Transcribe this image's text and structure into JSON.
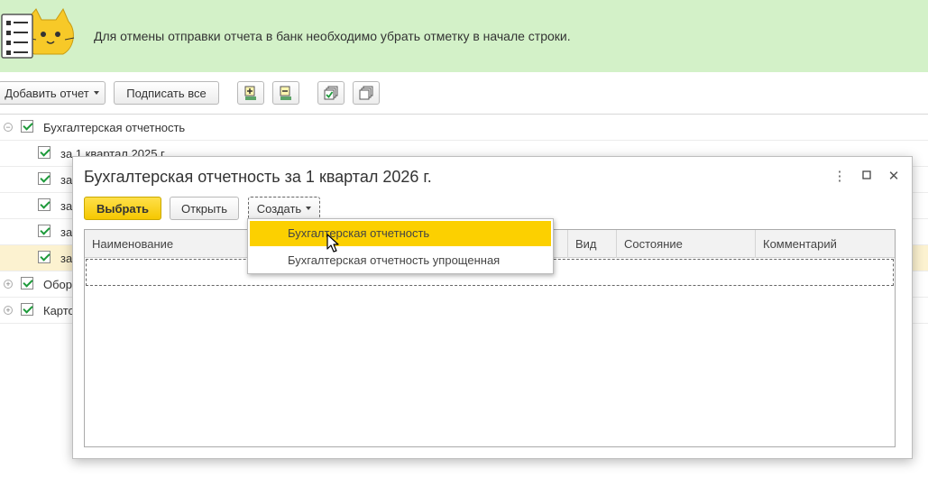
{
  "banner": {
    "message": "Для отмены отправки отчета в банк необходимо убрать отметку в начале строки.",
    "icon": "cat-checklist-icon"
  },
  "toolbar": {
    "add_report_label": "Добавить отчет",
    "sign_all_label": "Подписать все",
    "icons": [
      "expand-all-icon",
      "collapse-all-icon",
      "check-all-icon",
      "uncheck-all-icon"
    ]
  },
  "tree": {
    "rows": [
      {
        "label": "Бухгалтерская отчетность",
        "level": 0,
        "expanded": true,
        "checked": true
      },
      {
        "label": "за 1 квартал 2025 г.",
        "level": 1,
        "checked": true
      },
      {
        "label": "за",
        "level": 1,
        "checked": true
      },
      {
        "label": "за",
        "level": 1,
        "checked": true
      },
      {
        "label": "за",
        "level": 1,
        "checked": true
      },
      {
        "label": "за",
        "level": 1,
        "checked": true,
        "highlighted": true
      },
      {
        "label": "Обор",
        "level": 0,
        "expanded": false,
        "checked": true
      },
      {
        "label": "Карто",
        "level": 0,
        "expanded": false,
        "checked": true
      }
    ]
  },
  "dialog": {
    "title": "Бухгалтерская отчетность за 1 квартал 2026 г.",
    "select_label": "Выбрать",
    "open_label": "Открыть",
    "create_label": "Создать",
    "columns": [
      "Наименование",
      "Вид",
      "Состояние",
      "Комментарий"
    ],
    "controls": [
      "more-icon",
      "maximize-icon",
      "close-icon"
    ]
  },
  "dropdown": {
    "items": [
      {
        "label": "Бухгалтерская отчетность",
        "active": true
      },
      {
        "label": "Бухгалтерская отчетность упрощенная",
        "active": false
      }
    ]
  },
  "colors": {
    "banner_bg": "#d3f1c8",
    "primary": "#f5c800",
    "highlight_row": "#fcf2d0",
    "menu_active": "#fcd000",
    "check": "#1d9a3a"
  }
}
